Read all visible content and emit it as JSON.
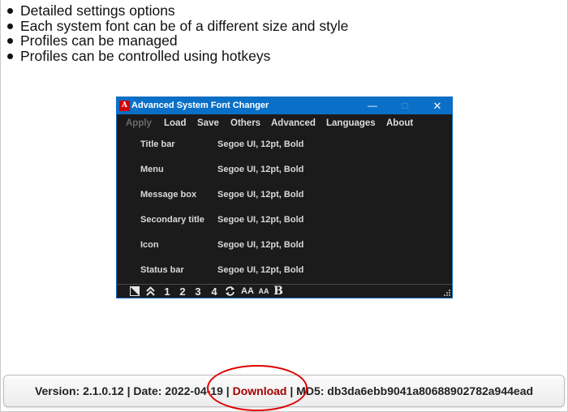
{
  "features": [
    "Detailed settings options",
    "Each system font can be of a different size and style",
    "Profiles can be managed",
    "Profiles can be controlled using hotkeys"
  ],
  "app": {
    "logo_text": "A",
    "title": "Advanced System Font Changer",
    "window_controls": {
      "minimize": "—",
      "maximize": "□",
      "close": "✕"
    },
    "menu": [
      "Apply",
      "Load",
      "Save",
      "Others",
      "Advanced",
      "Languages",
      "About"
    ],
    "settings": [
      {
        "label": "Title bar",
        "value": "Segoe UI, 12pt, Bold"
      },
      {
        "label": "Menu",
        "value": "Segoe UI, 12pt, Bold"
      },
      {
        "label": "Message box",
        "value": "Segoe UI, 12pt, Bold"
      },
      {
        "label": "Secondary title",
        "value": "Segoe UI, 12pt, Bold"
      },
      {
        "label": "Icon",
        "value": "Segoe UI, 12pt, Bold"
      },
      {
        "label": "Status bar",
        "value": "Segoe UI, 12pt, Bold"
      }
    ],
    "toolbar": {
      "icons": [
        "theme-toggle-icon",
        "collapse-up-icon",
        "refresh-icon",
        "font-size-icon",
        "font-size-small-icon",
        "bold-icon"
      ],
      "profiles": [
        "1",
        "2",
        "3",
        "4"
      ],
      "aa_large": "AA",
      "aa_small": "AA",
      "bold": "B"
    }
  },
  "footer": {
    "version_text": "Version: 2.1.0.12 | Date: 2022-04-19 | ",
    "download_label": "Download",
    "md5_text": " | MD5: db3da6ebb9041a80688902782a944ead",
    "link_color": "#a40000",
    "highlight_color": "#e00000"
  }
}
